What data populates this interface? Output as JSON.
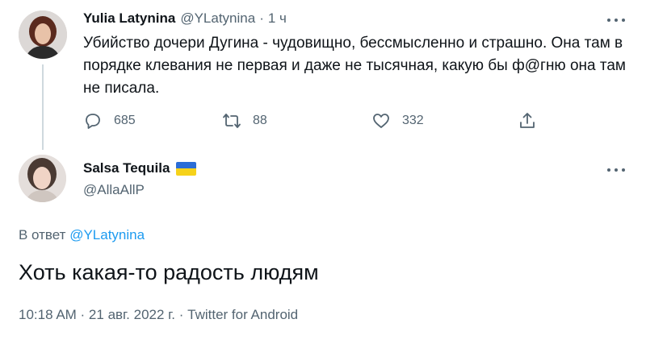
{
  "parent_tweet": {
    "author_name": "Yulia Latynina",
    "handle": "@YLatynina",
    "separator": "·",
    "time": "1 ч",
    "text": "Убийство дочери Дугина - чудовищно, бессмысленно и страшно. Она там в порядке клевания не первая и даже не тысячная, какую бы ф@гню она там не писала.",
    "replies": "685",
    "retweets": "88",
    "likes": "332"
  },
  "reply_tweet": {
    "author_name": "Salsa Tequila",
    "handle": "@AllaAllP",
    "flag": "ukraine-flag",
    "reply_prefix": "В ответ",
    "reply_mention": "@YLatynina",
    "text": "Хоть какая-то радость людям",
    "meta": "10:18 AM · 21 авг. 2022 г. · Twitter for Android"
  },
  "colors": {
    "text": "#0f1419",
    "secondary": "#536471",
    "link": "#1d9bf0",
    "thread_line": "#cfd9de"
  },
  "icons": [
    "reply-icon",
    "retweet-icon",
    "like-icon",
    "share-icon",
    "more-icon"
  ]
}
